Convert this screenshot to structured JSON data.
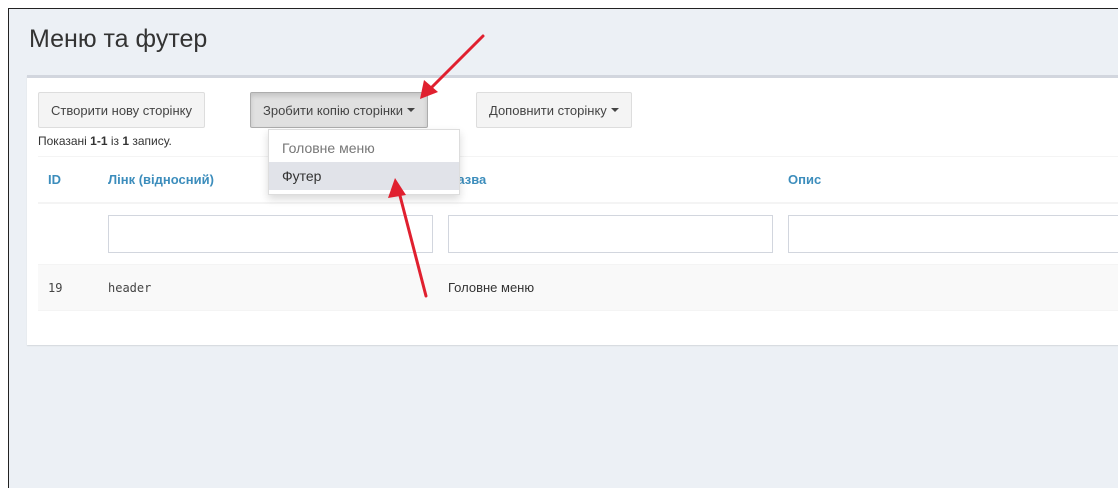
{
  "page": {
    "title": "Меню та футер"
  },
  "toolbar": {
    "create_label": "Створити нову сторінку",
    "copy_label": "Зробити копію сторінки",
    "extend_label": "Доповнити сторінку"
  },
  "summary": {
    "prefix": "Показані ",
    "range": "1-1",
    "middle": " із ",
    "total": "1",
    "suffix": " запису."
  },
  "dropdown": {
    "items": [
      "Головне меню",
      "Футер"
    ]
  },
  "table": {
    "headers": [
      "ID",
      "Лінк (відносний)",
      "Назва",
      "Опис"
    ],
    "rows": [
      {
        "id": "19",
        "link": "header",
        "name": "Головне меню",
        "description": ""
      }
    ]
  },
  "colors": {
    "background": "#ecf0f5",
    "link": "#3c8dbc",
    "arrow": "#e0202f"
  }
}
